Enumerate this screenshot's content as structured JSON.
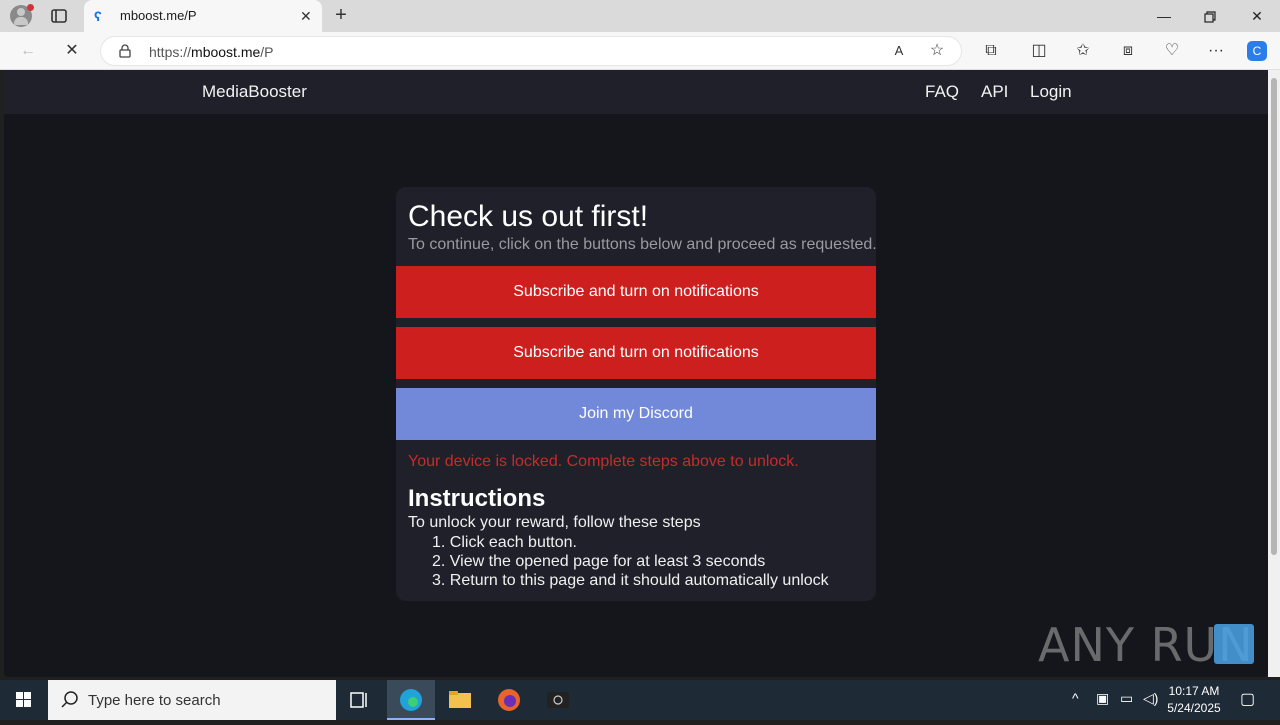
{
  "browser": {
    "tab_title": "mboost.me/P",
    "url_scheme": "https://",
    "url_host": "mboost.me",
    "url_path": "/P"
  },
  "site": {
    "brand": "MediaBooster",
    "nav": [
      "FAQ",
      "API",
      "Login"
    ]
  },
  "card": {
    "title": "Check us out first!",
    "subtitle": "To continue, click on the buttons below and proceed as requested.",
    "buttons": [
      {
        "label": "Subscribe and turn on notifications",
        "color": "#ce1f1f"
      },
      {
        "label": "Subscribe and turn on notifications",
        "color": "#ce1f1f"
      },
      {
        "label": "Join my Discord",
        "color": "#7289da"
      }
    ],
    "locked_message": "Your device is locked. Complete steps above to unlock.",
    "instructions_heading": "Instructions",
    "instructions_intro": "To unlock your reward, follow these steps",
    "steps": [
      "1. Click each button.",
      "2. View the opened page for at least 3 seconds",
      "3. Return to this page and it should automatically unlock"
    ]
  },
  "watermark": "ANY RUN",
  "taskbar": {
    "search_placeholder": "Type here to search",
    "time": "10:17 AM",
    "date": "5/24/2025"
  }
}
